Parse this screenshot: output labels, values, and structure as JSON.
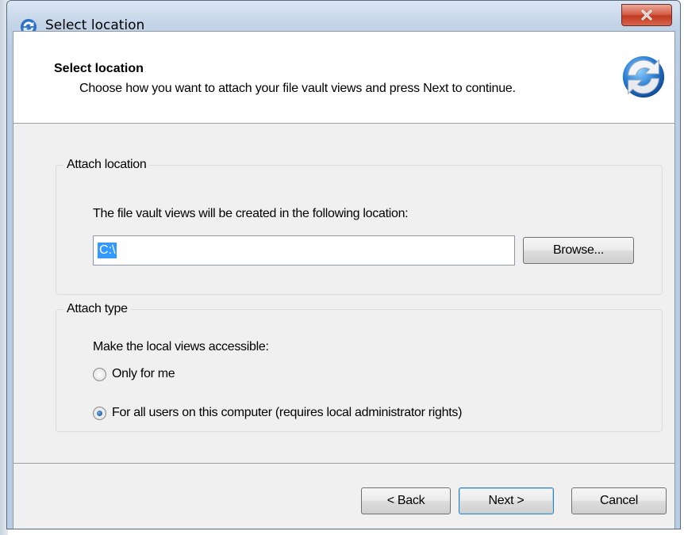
{
  "window": {
    "title": "Select location",
    "close_label": "close"
  },
  "header": {
    "title": "Select location",
    "subtitle": "Choose how you want to attach your file vault views and press Next to continue."
  },
  "attach_location": {
    "legend": "Attach location",
    "description": "The file vault views will be created in the following location:",
    "path_value": "C:\\",
    "browse_label": "Browse..."
  },
  "attach_type": {
    "legend": "Attach type",
    "description": "Make the local views accessible:",
    "options": [
      {
        "label": "Only for me",
        "checked": false
      },
      {
        "label": "For all users on this computer (requires local administrator rights)",
        "checked": true
      }
    ]
  },
  "footer": {
    "back_label": "< Back",
    "next_label": "Next >",
    "cancel_label": "Cancel"
  },
  "colors": {
    "accent": "#3399ff",
    "close_red": "#c13b22",
    "dialog_bg": "#f0f0f0"
  },
  "icons": {
    "title_icon": "sync-arrows-icon",
    "header_icon": "sync-arrows-icon"
  }
}
